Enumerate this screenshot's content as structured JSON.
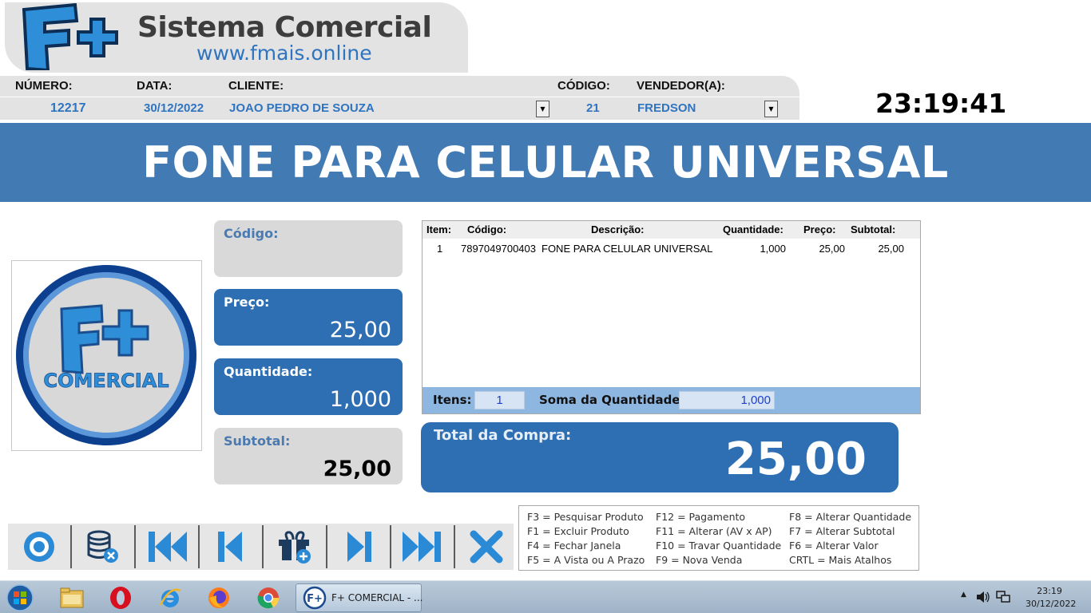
{
  "brand": {
    "title": "Sistema Comercial",
    "url": "www.fmais.online",
    "logo_mark": "F+",
    "product_logo_word": "COMERCIAL"
  },
  "header": {
    "labels": {
      "numero": "NÚMERO:",
      "data": "DATA:",
      "cliente": "CLIENTE:",
      "codigo": "CÓDIGO:",
      "vendedor": "VENDEDOR(A):"
    },
    "values": {
      "numero": "12217",
      "data": "30/12/2022",
      "cliente": "JOAO PEDRO DE SOUZA",
      "codigo": "21",
      "vendedor": "FREDSON"
    }
  },
  "clock": "23:19:41",
  "product_name": "FONE PARA CELULAR UNIVERSAL",
  "cards": {
    "codigo": {
      "label": "Código:",
      "value": ""
    },
    "preco": {
      "label": "Preço:",
      "value": "25,00"
    },
    "quantidade": {
      "label": "Quantidade:",
      "value": "1,000"
    },
    "subtotal": {
      "label": "Subtotal:",
      "value": "25,00"
    }
  },
  "table": {
    "headers": {
      "item": "Item:",
      "codigo": "Código:",
      "descricao": "Descrição:",
      "quantidade": "Quantidade:",
      "preco": "Preço:",
      "subtotal": "Subtotal:"
    },
    "rows": [
      {
        "item": "1",
        "codigo": "7897049700403",
        "descricao": "FONE PARA CELULAR UNIVERSAL",
        "quantidade": "1,000",
        "preco": "25,00",
        "subtotal": "25,00"
      }
    ],
    "footer": {
      "itens_label": "Itens:",
      "itens_value": "1",
      "soma_label": "Soma da Quantidade:",
      "soma_value": "1,000"
    }
  },
  "total": {
    "label": "Total da Compra:",
    "value": "25,00"
  },
  "toolbar_icons": [
    "disc-icon",
    "database-remove-icon",
    "first-record-icon",
    "previous-record-icon",
    "add-product-icon",
    "next-record-icon",
    "last-record-icon",
    "close-icon"
  ],
  "shortcuts": [
    [
      "F3 = Pesquisar Produto",
      "F12 = Pagamento",
      "F8 = Alterar Quantidade"
    ],
    [
      "F1 = Excluir Produto",
      "F11 = Alterar (AV x AP)",
      "F7 = Alterar Subtotal"
    ],
    [
      "F4 = Fechar Janela",
      "F10 = Travar Quantidade",
      "F6 = Alterar Valor"
    ],
    [
      "F5 = A Vista ou A Prazo",
      "F9 = Nova Venda",
      "CRTL = Mais Atalhos"
    ]
  ],
  "taskbar": {
    "app_label": "F+ COMERCIAL - ...",
    "time": "23:19",
    "date": "30/12/2022"
  },
  "colors": {
    "accent_blue": "#2e6fb3",
    "banner_blue": "#427ab3",
    "link_blue": "#2f74c0",
    "panel_gray": "#d9d9d9"
  }
}
